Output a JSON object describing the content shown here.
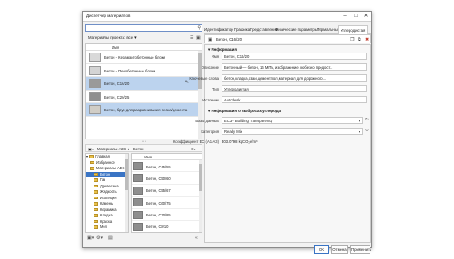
{
  "window": {
    "title": "Диспетчер материалов",
    "minimize": "–",
    "maximize": "□",
    "close": "✕"
  },
  "search": {
    "placeholder": ""
  },
  "project_bar": {
    "label": "Материалы проекта: все"
  },
  "project_list": {
    "header": "Имя",
    "items": [
      {
        "name": "Бетон - Керамзитобетонные блоки",
        "swatch": "#d9d9d9",
        "selected": false
      },
      {
        "name": "Бетон - Пенобетонные блоки",
        "swatch": "#d4d4d4",
        "selected": false
      },
      {
        "name": "Бетон, C16/20",
        "swatch": "#9a9a9a",
        "selected": true
      },
      {
        "name": "Бетон, C20/25",
        "swatch": "#8f8f8f",
        "selected": false
      },
      {
        "name": "Бетон, брус для разравнивания песка/цемента",
        "swatch": "#d0cdc6",
        "selected": true
      }
    ]
  },
  "library_bar": {
    "lib": "Материалы AEC",
    "sep": "›",
    "crumb": "Бетон"
  },
  "tree": [
    {
      "label": "Главная",
      "sel": false,
      "expanded": true
    },
    {
      "label": "Избранное",
      "sel": false
    },
    {
      "label": "Материалы AEC",
      "sel": false
    },
    {
      "label": "Бетон",
      "sel": true
    },
    {
      "label": "Газ",
      "sel": false
    },
    {
      "label": "Древесина",
      "sel": false
    },
    {
      "label": "Жидкость",
      "sel": false
    },
    {
      "label": "Изоляция",
      "sel": false
    },
    {
      "label": "Камень",
      "sel": false
    },
    {
      "label": "Керамика",
      "sel": false
    },
    {
      "label": "Кладка",
      "sel": false
    },
    {
      "label": "Краска",
      "sel": false
    },
    {
      "label": "Мел",
      "sel": false
    },
    {
      "label": "Мозаика",
      "sel": false
    }
  ],
  "library_list": {
    "header": "Имя",
    "items": [
      "Бетон, C45/55",
      "Бетон, C50/60",
      "Бетон, C55/67",
      "Бетон, C60/75",
      "Бетон, C70/85",
      "Бетон, C8/10"
    ]
  },
  "tabs": [
    "Идентификатор",
    "Графика",
    "Представление",
    "Физические параметры",
    "Термальные",
    "Углеродистая"
  ],
  "material_header": {
    "name": "Бетон, C16/20"
  },
  "info": {
    "section": "Информация",
    "fields": [
      {
        "label": "Имя",
        "value": "Бетон, C16/20"
      },
      {
        "label": "Описание",
        "value": "Бетонный — бетон, 16 МПа, изображение любезно предост..."
      },
      {
        "label": "Ключевые слова",
        "value": "бетон,кладка,сваи,цемент,пол,материал для дорожного..."
      },
      {
        "label": "Тип",
        "value": "Углеродистая"
      },
      {
        "label": "Источник",
        "value": "Autodesk"
      }
    ]
  },
  "carbon": {
    "section": "Информация о выбросах углерода",
    "db_label": "Базы данных",
    "db_value": "EC3 - Building Transparency",
    "cat_label": "Категория",
    "cat_value": "Ready Mix",
    "coef_label": "Коэффициент EC (A1-A3)",
    "coef_value": "303.0798 kgCO₂e/m³"
  },
  "buttons": {
    "ok": "OK",
    "cancel": "Отмена",
    "apply": "Применить"
  },
  "icons": {
    "search": "search-icon",
    "dropdown": "dropdown-icon",
    "pin": "pin-icon"
  }
}
